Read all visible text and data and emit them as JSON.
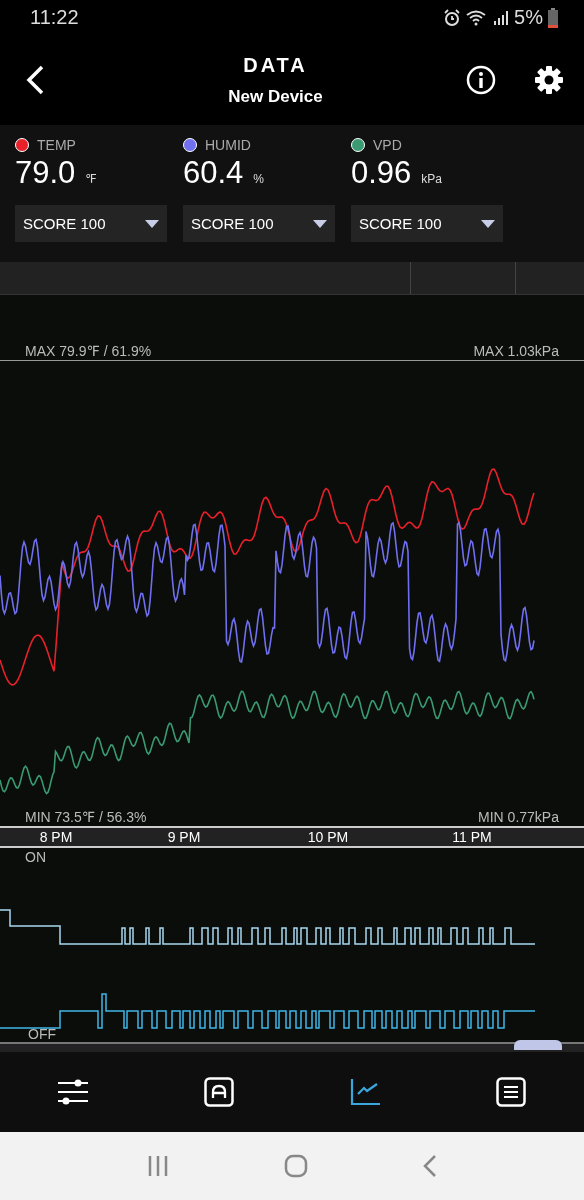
{
  "status_bar": {
    "time": "11:22",
    "battery": "5%"
  },
  "header": {
    "title": "DATA",
    "subtitle": "New Device"
  },
  "sensors": [
    {
      "name": "TEMP",
      "color": "#e8202a",
      "value": "79.0",
      "unit": "℉",
      "score": "SCORE 100"
    },
    {
      "name": "HUMID",
      "color": "#6f6ff0",
      "value": "60.4",
      "unit": "%",
      "score": "SCORE 100"
    },
    {
      "name": "VPD",
      "color": "#3a9a72",
      "value": "0.96",
      "unit": "kPa",
      "score": "SCORE 100"
    }
  ],
  "chart": {
    "max_left": "MAX 79.9℉ / 61.9%",
    "max_right": "MAX 1.03kPa",
    "min_left": "MIN 73.5℉ / 56.3%",
    "min_right": "MIN 0.77kPa",
    "xticks": [
      "8 PM",
      "9 PM",
      "10 PM",
      "11 PM"
    ]
  },
  "switch_chart": {
    "on_label": "ON",
    "off_label": "OFF"
  },
  "bottom_nav": [
    {
      "kind": "sliders",
      "selected": false
    },
    {
      "kind": "auto",
      "selected": false
    },
    {
      "kind": "chart",
      "selected": true
    },
    {
      "kind": "list",
      "selected": false
    }
  ]
}
